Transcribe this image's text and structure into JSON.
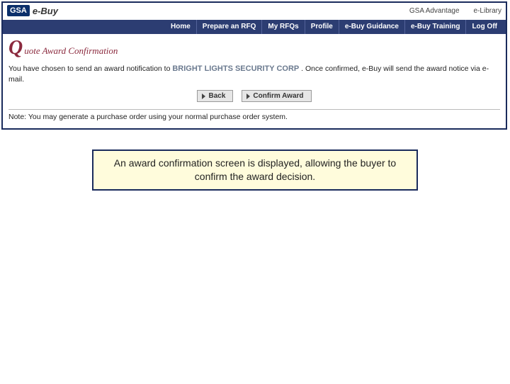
{
  "logo": {
    "badge": "GSA",
    "product": "e-Buy"
  },
  "toplinks": {
    "advantage": "GSA Advantage",
    "elibrary": "e-Library"
  },
  "nav": {
    "home": "Home",
    "prepare": "Prepare an RFQ",
    "myrfqs": "My RFQs",
    "profile": "Profile",
    "guidance": "e-Buy Guidance",
    "training": "e-Buy Training",
    "logoff": "Log Off"
  },
  "title": {
    "initial": "Q",
    "rest": "uote Award Confirmation"
  },
  "body": {
    "intro_before": "You have chosen to send an award notification to ",
    "vendor": "BRIGHT LIGHTS SECURITY CORP",
    "intro_after": ". Once confirmed, e-Buy will send the award notice via e-mail.",
    "note": "Note: You may generate a purchase order using your normal purchase order system."
  },
  "buttons": {
    "back": "Back",
    "confirm": "Confirm Award"
  },
  "callout": "An award confirmation screen is displayed, allowing the buyer to confirm the award decision."
}
